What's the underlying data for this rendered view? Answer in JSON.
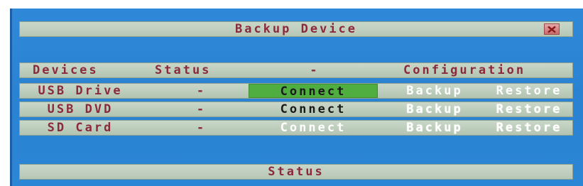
{
  "dialog": {
    "title": "Backup Device",
    "close_icon": "close-x-icon",
    "status_label": "Status"
  },
  "table": {
    "headers": {
      "devices": "Devices",
      "status": "Status",
      "dash": "-",
      "configuration": "Configuration"
    },
    "rows": [
      {
        "device": "USB Drive",
        "status": "-",
        "connect": "Connect",
        "backup": "Backup",
        "restore": "Restore",
        "connect_selected": true
      },
      {
        "device": "USB DVD",
        "status": "-",
        "connect": "Connect",
        "backup": "Backup",
        "restore": "Restore",
        "connect_selected": false
      },
      {
        "device": "SD Card",
        "status": "-",
        "connect": "Connect",
        "backup": "Backup",
        "restore": "Restore",
        "connect_selected": false
      }
    ]
  },
  "colors": {
    "background": "#2b86d5",
    "bar": "#c1d0c0",
    "label_text": "#8a2a3a",
    "selected": "#4fae3f",
    "close_button": "#d27c7c"
  }
}
